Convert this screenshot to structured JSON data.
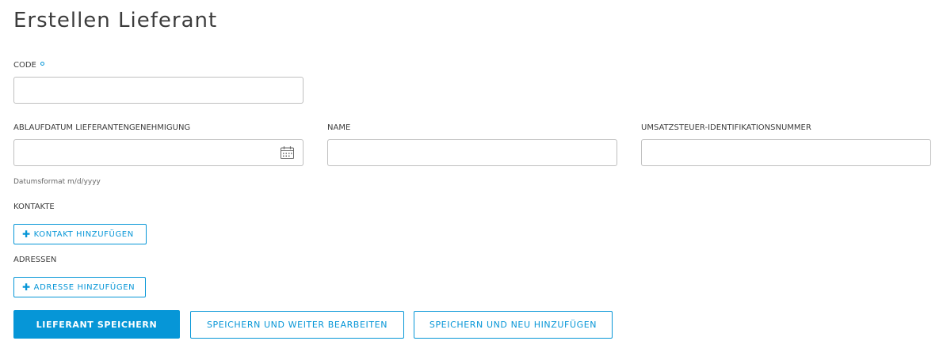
{
  "page": {
    "title": "Erstellen Lieferant"
  },
  "form": {
    "code": {
      "label": "CODE",
      "value": ""
    },
    "expiry": {
      "label": "ABLAUFDATUM LIEFERANTENGENEHMIGUNG",
      "value": "",
      "icon": "calendar-icon",
      "hint": "Datumsformat m/d/yyyy"
    },
    "name": {
      "label": "NAME",
      "value": ""
    },
    "vat": {
      "label": "UMSATZSTEUER-IDENTIFIKATIONSNUMMER",
      "value": ""
    },
    "contacts": {
      "label": "KONTAKTE",
      "add_label": "KONTAKT HINZUFÜGEN",
      "add_icon": "plus-icon"
    },
    "addresses": {
      "label": "ADRESSEN",
      "add_label": "ADRESSE HINZUFÜGEN",
      "add_icon": "plus-icon"
    }
  },
  "actions": {
    "save": "LIEFERANT SPEICHERN",
    "save_continue": "SPEICHERN UND WEITER BEARBEITEN",
    "save_new": "SPEICHERN UND NEU HINZUFÜGEN"
  },
  "colors": {
    "accent": "#0696d7",
    "border": "#bfbfbf",
    "text": "#3c3c3c"
  }
}
